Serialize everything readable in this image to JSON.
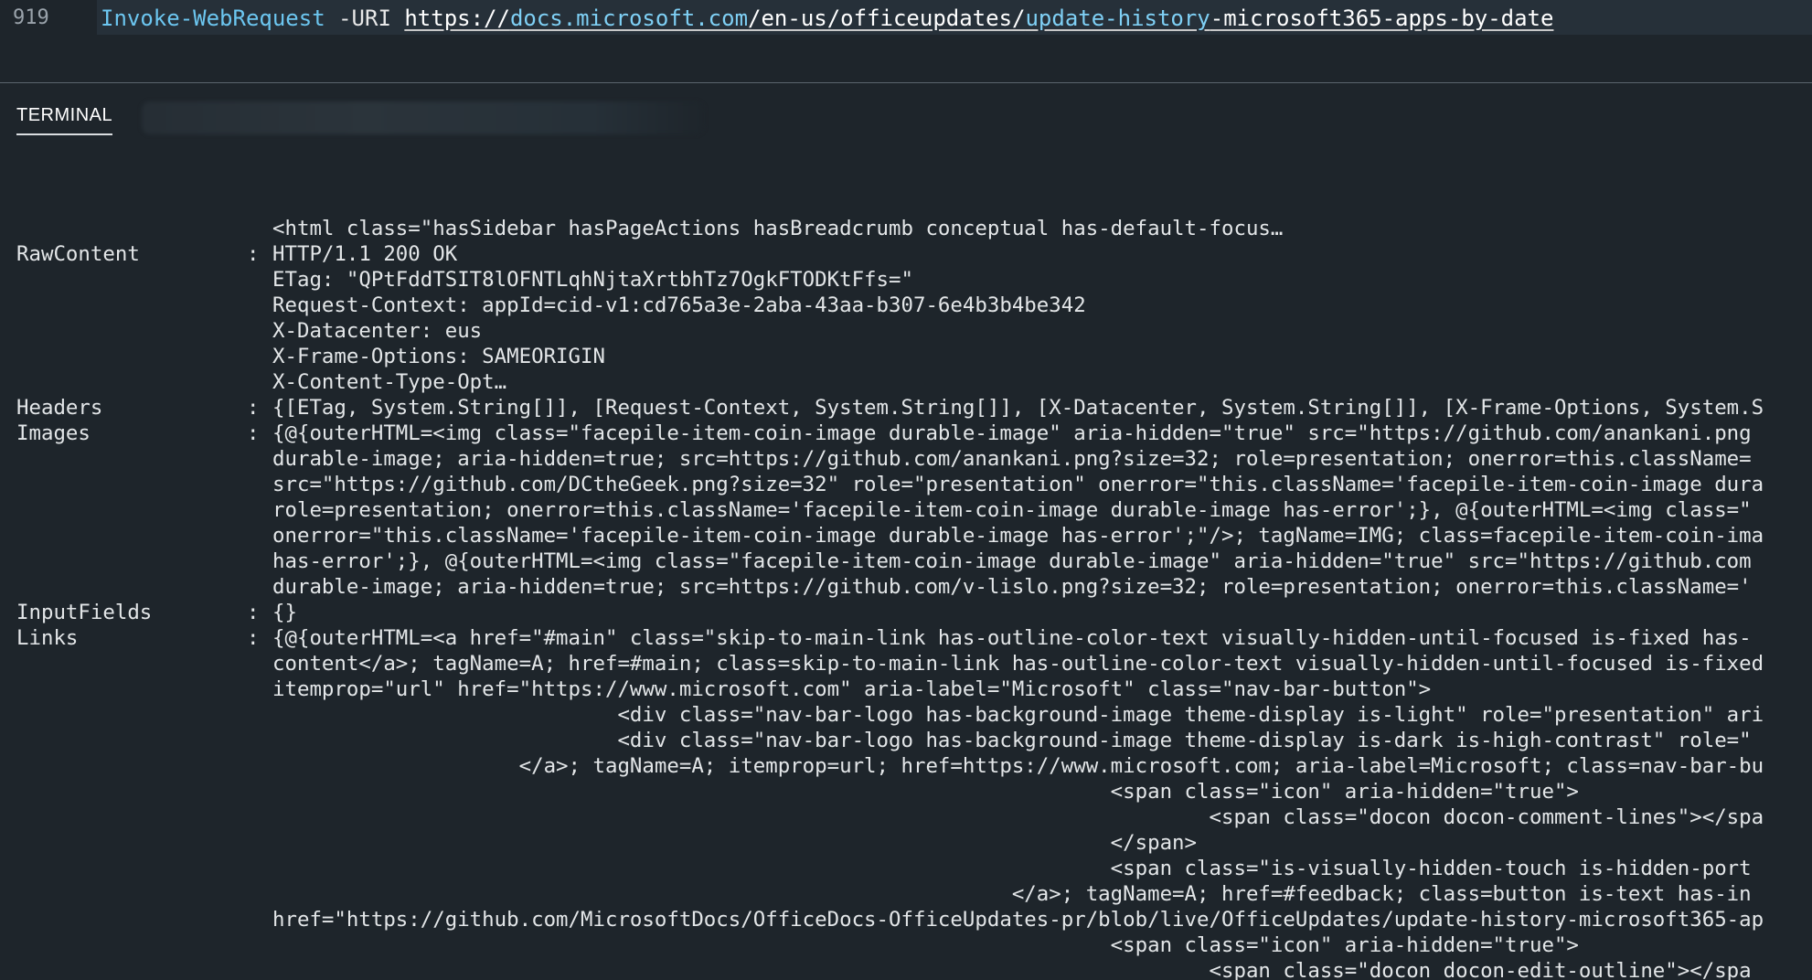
{
  "editor": {
    "line_number": "919",
    "command": "Invoke-WebRequest",
    "param": " -URI ",
    "url_parts": [
      "https://",
      "docs.microsoft.com",
      "/en-us/officeupdates/",
      "update-history",
      "-microsoft365-apps-by-date"
    ]
  },
  "panel": {
    "tab_label": "TERMINAL"
  },
  "terminal": {
    "rows": [
      {
        "label": "",
        "colon": "",
        "value": "<html class=\"hasSidebar hasPageActions hasBreadcrumb conceptual has-default-focus…"
      },
      {
        "label": "RawContent",
        "colon": ":",
        "value": "HTTP/1.1 200 OK"
      },
      {
        "label": "",
        "colon": "",
        "value": "ETag: \"QPtFddTSIT8lOFNTLqhNjtaXrtbhTz7OgkFTODKtFfs=\""
      },
      {
        "label": "",
        "colon": "",
        "value": "Request-Context: appId=cid-v1:cd765a3e-2aba-43aa-b307-6e4b3b4be342"
      },
      {
        "label": "",
        "colon": "",
        "value": "X-Datacenter: eus"
      },
      {
        "label": "",
        "colon": "",
        "value": "X-Frame-Options: SAMEORIGIN"
      },
      {
        "label": "",
        "colon": "",
        "value": "X-Content-Type-Opt…"
      },
      {
        "label": "Headers",
        "colon": ":",
        "value": "{[ETag, System.String[]], [Request-Context, System.String[]], [X-Datacenter, System.String[]], [X-Frame-Options, System.S"
      },
      {
        "label": "Images",
        "colon": ":",
        "value": "{@{outerHTML=<img class=\"facepile-item-coin-image durable-image\" aria-hidden=\"true\" src=\"https://github.com/anankani.png"
      },
      {
        "label": "",
        "colon": "",
        "value": "durable-image; aria-hidden=true; src=https://github.com/anankani.png?size=32; role=presentation; onerror=this.className="
      },
      {
        "label": "",
        "colon": "",
        "value": "src=\"https://github.com/DCtheGeek.png?size=32\" role=\"presentation\" onerror=\"this.className='facepile-item-coin-image dura"
      },
      {
        "label": "",
        "colon": "",
        "value": "role=presentation; onerror=this.className='facepile-item-coin-image durable-image has-error';}, @{outerHTML=<img class=\""
      },
      {
        "label": "",
        "colon": "",
        "value": "onerror=\"this.className='facepile-item-coin-image durable-image has-error';\"/>; tagName=IMG; class=facepile-item-coin-ima"
      },
      {
        "label": "",
        "colon": "",
        "value": "has-error';}, @{outerHTML=<img class=\"facepile-item-coin-image durable-image\" aria-hidden=\"true\" src=\"https://github.com"
      },
      {
        "label": "",
        "colon": "",
        "value": "durable-image; aria-hidden=true; src=https://github.com/v-lislo.png?size=32; role=presentation; onerror=this.className='"
      },
      {
        "label": "InputFields",
        "colon": ":",
        "value": "{}"
      },
      {
        "label": "Links",
        "colon": ":",
        "value": "{@{outerHTML=<a href=\"#main\" class=\"skip-to-main-link has-outline-color-text visually-hidden-until-focused is-fixed has-"
      },
      {
        "label": "",
        "colon": "",
        "value": "content</a>; tagName=A; href=#main; class=skip-to-main-link has-outline-color-text visually-hidden-until-focused is-fixed"
      },
      {
        "label": "",
        "colon": "",
        "value": "itemprop=\"url\" href=\"https://www.microsoft.com\" aria-label=\"Microsoft\" class=\"nav-bar-button\">"
      },
      {
        "label": "",
        "colon": "",
        "value": "                            <div class=\"nav-bar-logo has-background-image theme-display is-light\" role=\"presentation\" ari"
      },
      {
        "label": "",
        "colon": "",
        "value": "                            <div class=\"nav-bar-logo has-background-image theme-display is-dark is-high-contrast\" role=\""
      },
      {
        "label": "",
        "colon": "",
        "value": "                    </a>; tagName=A; itemprop=url; href=https://www.microsoft.com; aria-label=Microsoft; class=nav-bar-bu"
      },
      {
        "label": "",
        "colon": "",
        "value": "                                                                    <span class=\"icon\" aria-hidden=\"true\">"
      },
      {
        "label": "",
        "colon": "",
        "value": "                                                                            <span class=\"docon docon-comment-lines\"></spa"
      },
      {
        "label": "",
        "colon": "",
        "value": "                                                                    </span>"
      },
      {
        "label": "",
        "colon": "",
        "value": "                                                                    <span class=\"is-visually-hidden-touch is-hidden-port"
      },
      {
        "label": "",
        "colon": "",
        "value": "                                                            </a>; tagName=A; href=#feedback; class=button is-text has-in"
      },
      {
        "label": "",
        "colon": "",
        "value": "href=\"https://github.com/MicrosoftDocs/OfficeDocs-OfficeUpdates-pr/blob/live/OfficeUpdates/update-history-microsoft365-ap"
      },
      {
        "label": "",
        "colon": "",
        "value": "                                                                    <span class=\"icon\" aria-hidden=\"true\">"
      },
      {
        "label": "",
        "colon": "",
        "value": "                                                                            <span class=\"docon docon-edit-outline\"></spa"
      }
    ]
  }
}
